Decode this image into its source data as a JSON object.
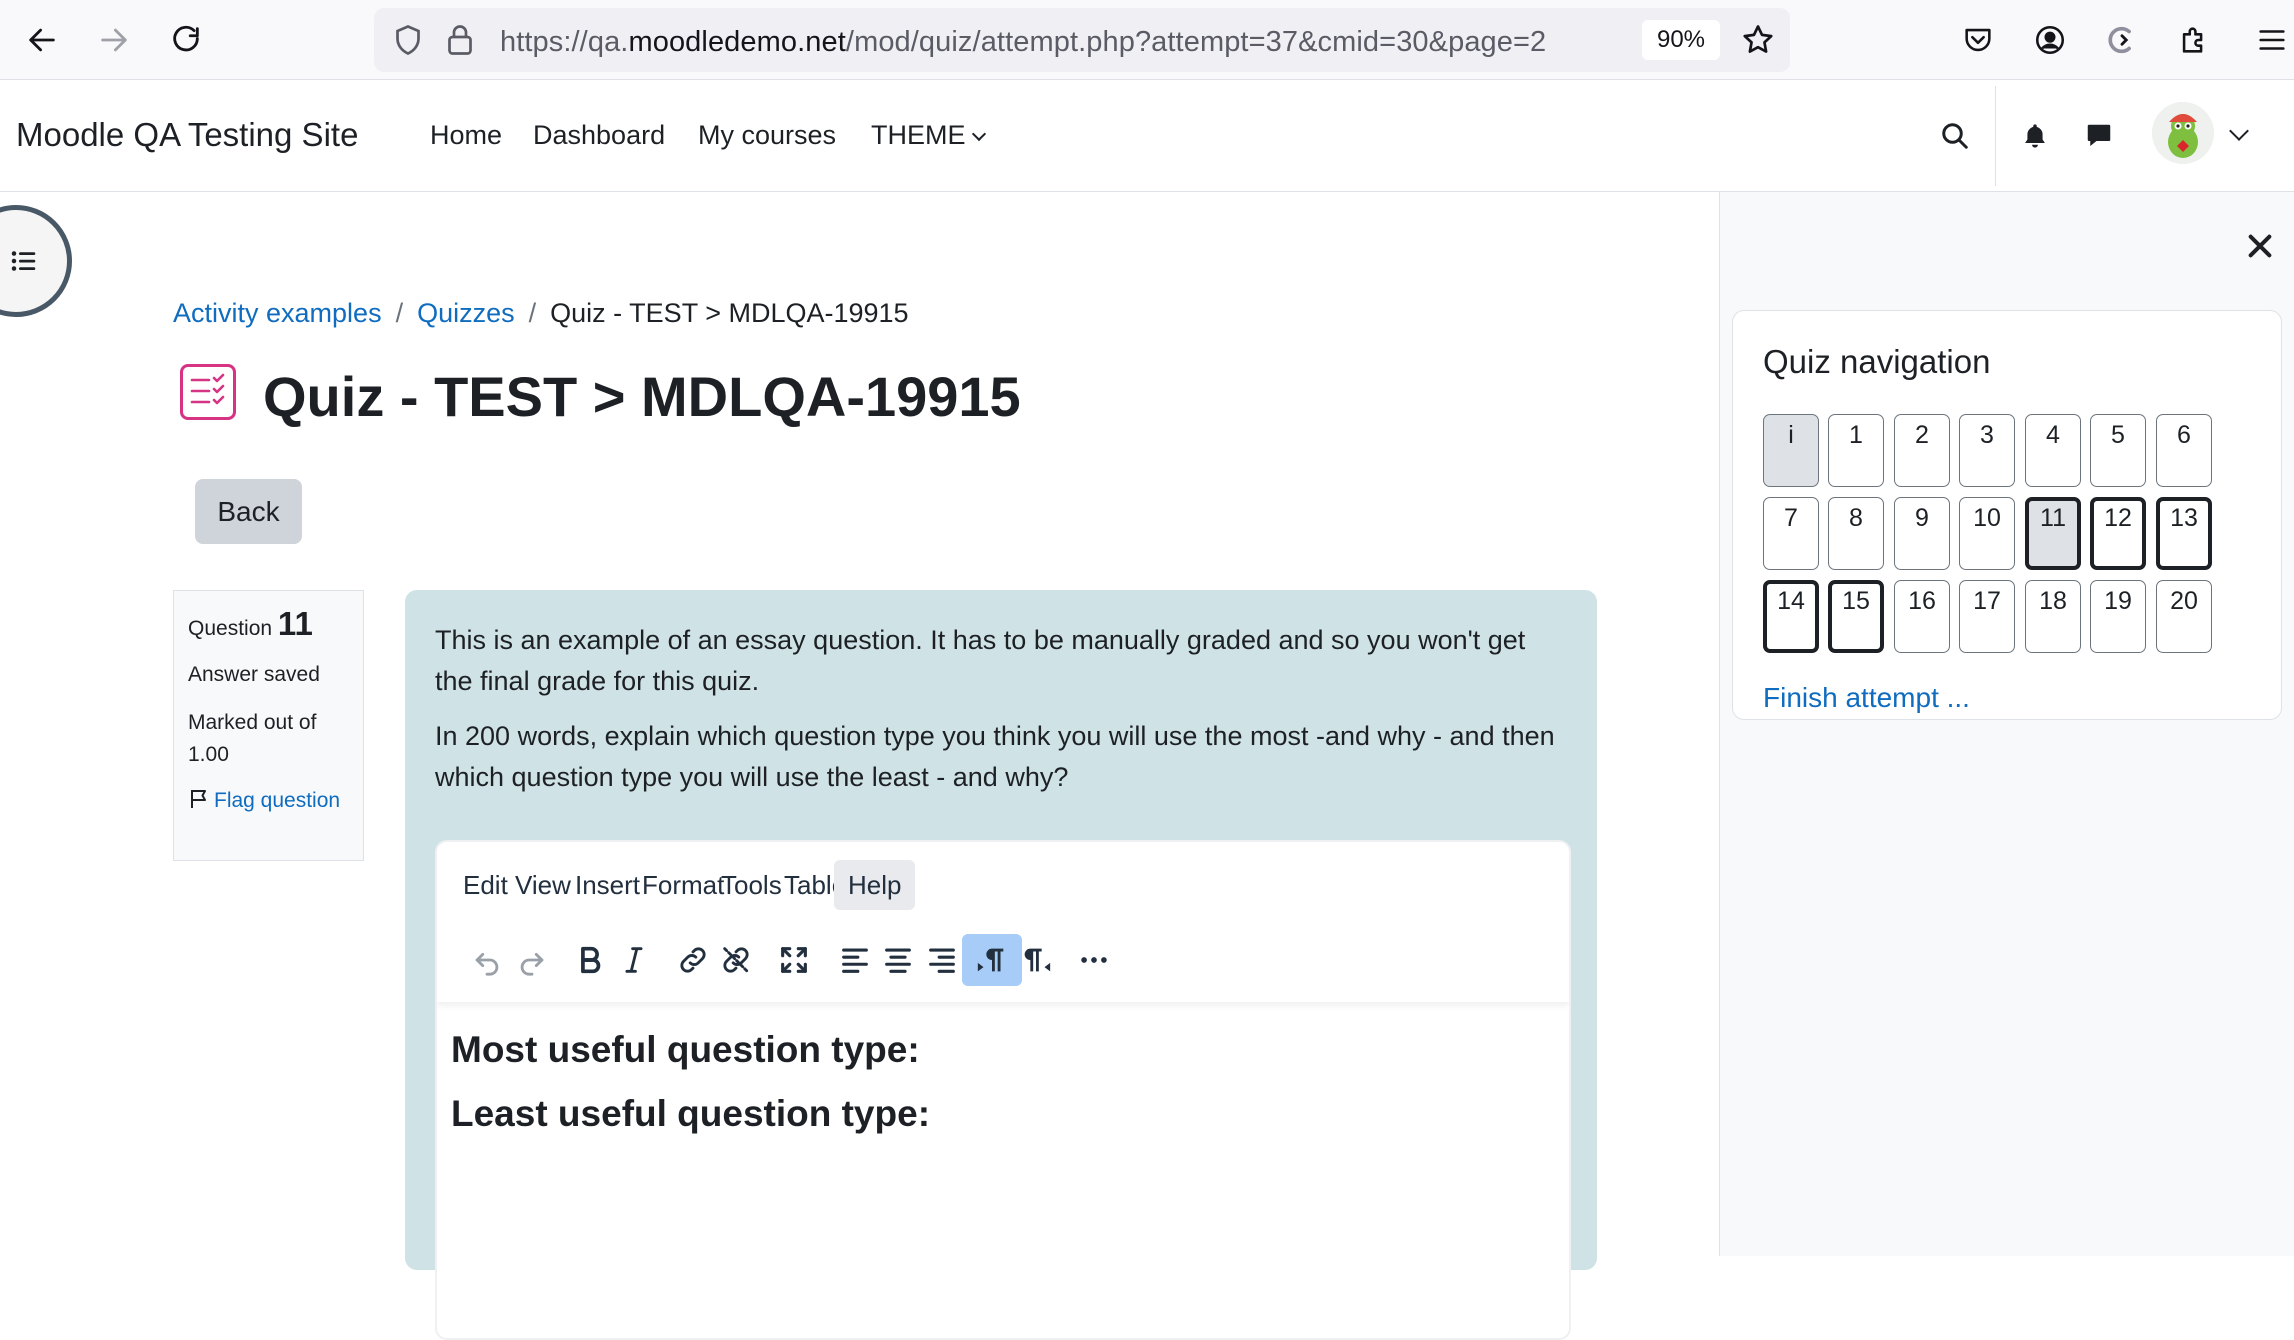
{
  "browser": {
    "url_prefix": "https://qa.",
    "url_domain": "moodledemo.net",
    "url_path": "/mod/quiz/attempt.php?attempt=37&cmid=30&page=2",
    "zoom": "90%"
  },
  "navbar": {
    "site_name": "Moodle QA Testing Site",
    "items": [
      {
        "label": "Home"
      },
      {
        "label": "Dashboard"
      },
      {
        "label": "My courses"
      },
      {
        "label": "THEME"
      }
    ]
  },
  "breadcrumb": {
    "items": [
      "Activity examples",
      "Quizzes"
    ],
    "separator": "/",
    "current": "Quiz - TEST > MDLQA-19915"
  },
  "page": {
    "title": "Quiz - TEST > MDLQA-19915",
    "back_label": "Back"
  },
  "question": {
    "label": "Question",
    "number": "11",
    "state": "Answer saved",
    "marked": "Marked out of 1.00",
    "flag_label": "Flag question",
    "text_p1": "This is an example of an essay question. It has to be manually graded and so you won't get the final grade for this quiz.",
    "text_p2": "In 200 words, explain which question type you think you will use the most  -and why - and then which question type you will use the least - and why?"
  },
  "editor": {
    "menu": [
      "Edit",
      "View",
      "Insert",
      "Format",
      "Tools",
      "Table",
      "Help"
    ],
    "active_menu": "Help",
    "toolbar": [
      "undo-icon",
      "redo-icon",
      "bold-icon",
      "italic-icon",
      "link-icon",
      "unlink-icon",
      "fullscreen-icon",
      "align-left-icon",
      "align-center-icon",
      "align-right-icon",
      "ltr-icon",
      "rtl-icon",
      "more-icon"
    ],
    "content": [
      "Most useful question type:",
      "Least useful question type:"
    ]
  },
  "quiz_nav": {
    "title": "Quiz navigation",
    "buttons": [
      "i",
      "1",
      "2",
      "3",
      "4",
      "5",
      "6",
      "7",
      "8",
      "9",
      "10",
      "11",
      "12",
      "13",
      "14",
      "15",
      "16",
      "17",
      "18",
      "19",
      "20"
    ],
    "current": "11",
    "finish_label": "Finish attempt ..."
  },
  "colors": {
    "link": "#0f6cbf",
    "question_bg": "#cfe2e6",
    "quiz_icon": "#d63384",
    "active_toolbar": "#a6ccf7"
  }
}
